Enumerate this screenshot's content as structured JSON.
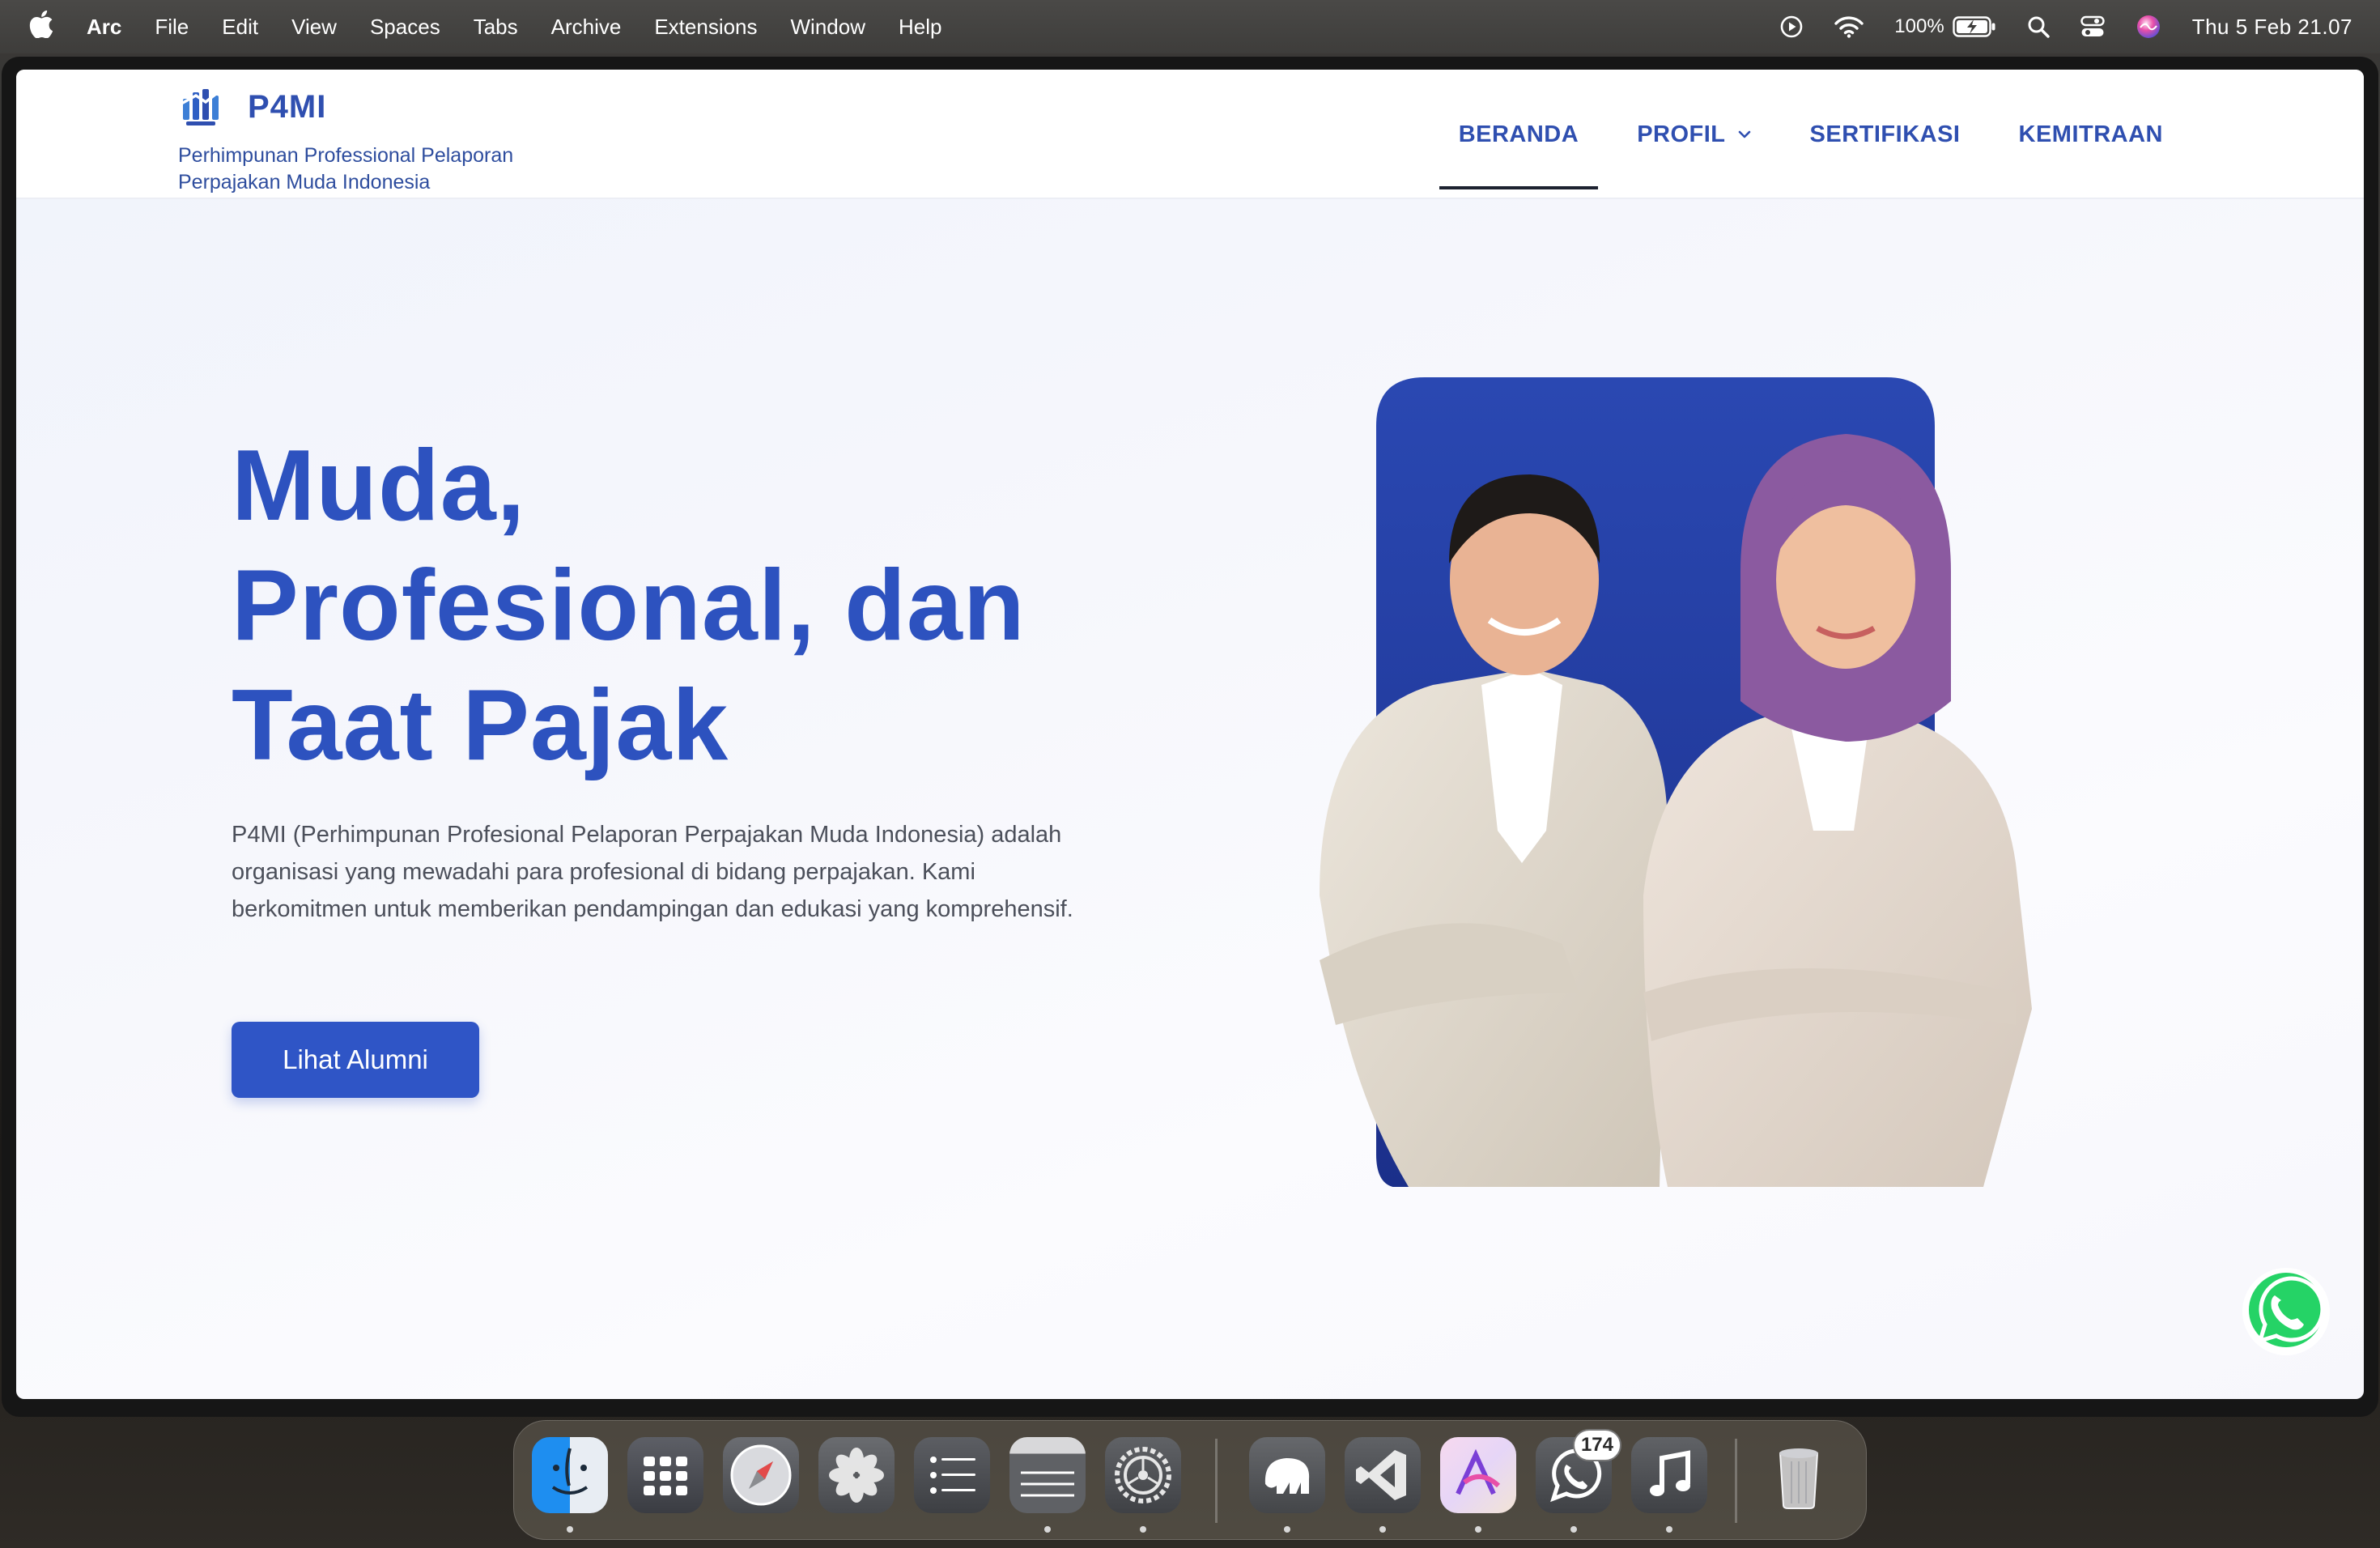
{
  "menubar": {
    "app_name": "Arc",
    "items": [
      "File",
      "Edit",
      "View",
      "Spaces",
      "Tabs",
      "Archive",
      "Extensions",
      "Window",
      "Help"
    ],
    "battery": "100%",
    "clock": "Thu 5 Feb  21.07"
  },
  "site": {
    "brand_name": "P4MI",
    "tagline": "Perhimpunan Professional Pelaporan Perpajakan Muda Indonesia",
    "nav": [
      "BERANDA",
      "PROFIL",
      "SERTIFIKASI",
      "KEMITRAAN"
    ],
    "nav_active": "BERANDA"
  },
  "hero": {
    "title_line1": "Muda,",
    "title_line2": "Profesional, dan",
    "title_line3": "Taat Pajak",
    "description": "P4MI (Perhimpunan Profesional Pelaporan Perpajakan Muda Indonesia) adalah organisasi yang mewadahi para profesional di bidang perpajakan. Kami berkomitmen untuk memberikan pendampingan dan edukasi yang komprehensif.",
    "cta_label": "Lihat Alumni"
  },
  "dock": {
    "apps": [
      "finder-icon",
      "launchpad-icon",
      "safari-icon",
      "photos-icon",
      "reminders-icon",
      "notes-icon",
      "system-settings-icon",
      "tableplus-icon",
      "vscode-icon",
      "affinity-icon",
      "whatsapp-icon",
      "music-icon",
      "trash-icon"
    ],
    "whatsapp_badge": "174"
  },
  "colors": {
    "brand_blue": "#2f4fb0",
    "hero_blue": "#2d52bf",
    "button_blue": "#2f55c6",
    "photo_backdrop": "#233fa3",
    "whatsapp_green": "#25d366"
  }
}
